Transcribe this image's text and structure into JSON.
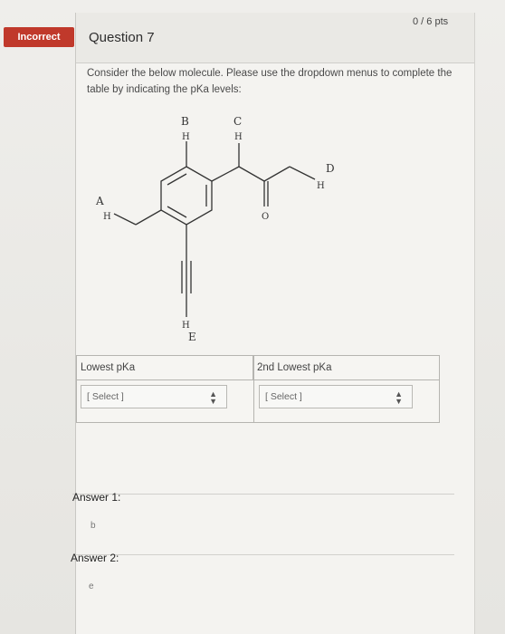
{
  "header": {
    "badge": "Incorrect",
    "question_title": "Question 7",
    "points": "0 / 6 pts"
  },
  "prompt": "Consider the below molecule. Please use the dropdown menus to complete the table by indicating the pKa levels:",
  "molecule": {
    "labels": {
      "A": "A",
      "B": "B",
      "C": "C",
      "D": "D",
      "E": "E",
      "H": "H",
      "O": "O"
    }
  },
  "table": {
    "headers": [
      "Lowest pKa",
      "2nd Lowest pKa"
    ],
    "selects": [
      "[ Select ]",
      "[ Select ]"
    ]
  },
  "answers": [
    {
      "label": "Answer 1:",
      "value": "b"
    },
    {
      "label": "Answer 2:",
      "value": "e"
    }
  ],
  "colors": {
    "incorrect_badge": "#c0392b"
  }
}
